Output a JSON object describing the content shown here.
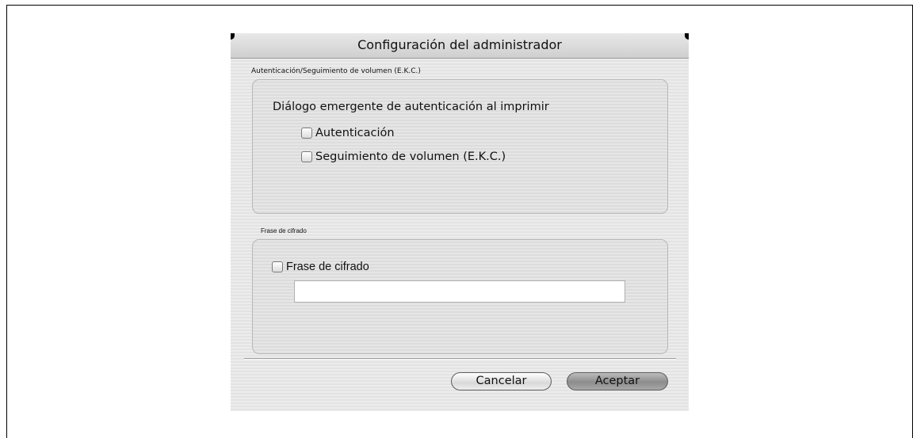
{
  "dialog": {
    "title": "Configuración del administrador"
  },
  "auth_group": {
    "label": "Autenticación/Seguimiento de volumen (E.K.C.)",
    "heading": "Diálogo emergente de autenticación al imprimir",
    "checkbox_auth": {
      "label": "Autenticación",
      "checked": false
    },
    "checkbox_ekc": {
      "label": "Seguimiento de volumen (E.K.C.)",
      "checked": false
    }
  },
  "passphrase_group": {
    "label": "Frase de cifrado",
    "checkbox": {
      "label": "Frase de cifrado",
      "checked": false
    },
    "input_value": ""
  },
  "buttons": {
    "cancel": "Cancelar",
    "ok": "Aceptar"
  }
}
